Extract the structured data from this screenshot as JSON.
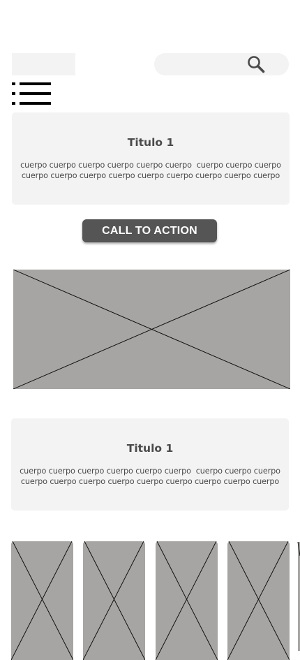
{
  "header": {
    "logo_icon": "logo-placeholder",
    "search_icon": "search-icon",
    "menu_icon": "list-menu-icon"
  },
  "sections": [
    {
      "title": "Titulo 1",
      "body": "cuerpo cuerpo cuerpo cuerpo cuerpo cuerpo  cuerpo cuerpo cuerpo\ncuerpo cuerpo cuerpo cuerpo cuerpo cuerpo cuerpo cuerpo cuerpo"
    },
    {
      "title": "Titulo 1",
      "body": "cuerpo cuerpo cuerpo cuerpo cuerpo cuerpo  cuerpo cuerpo cuerpo\ncuerpo cuerpo cuerpo cuerpo cuerpo cuerpo cuerpo cuerpo cuerpo"
    }
  ],
  "cta": {
    "label": "CALL TO ACTION"
  },
  "colors": {
    "card_bg": "#f3f3f3",
    "cta_bg": "#555555",
    "placeholder_gray": "#a6a5a3",
    "text": "#4a4a4a"
  }
}
